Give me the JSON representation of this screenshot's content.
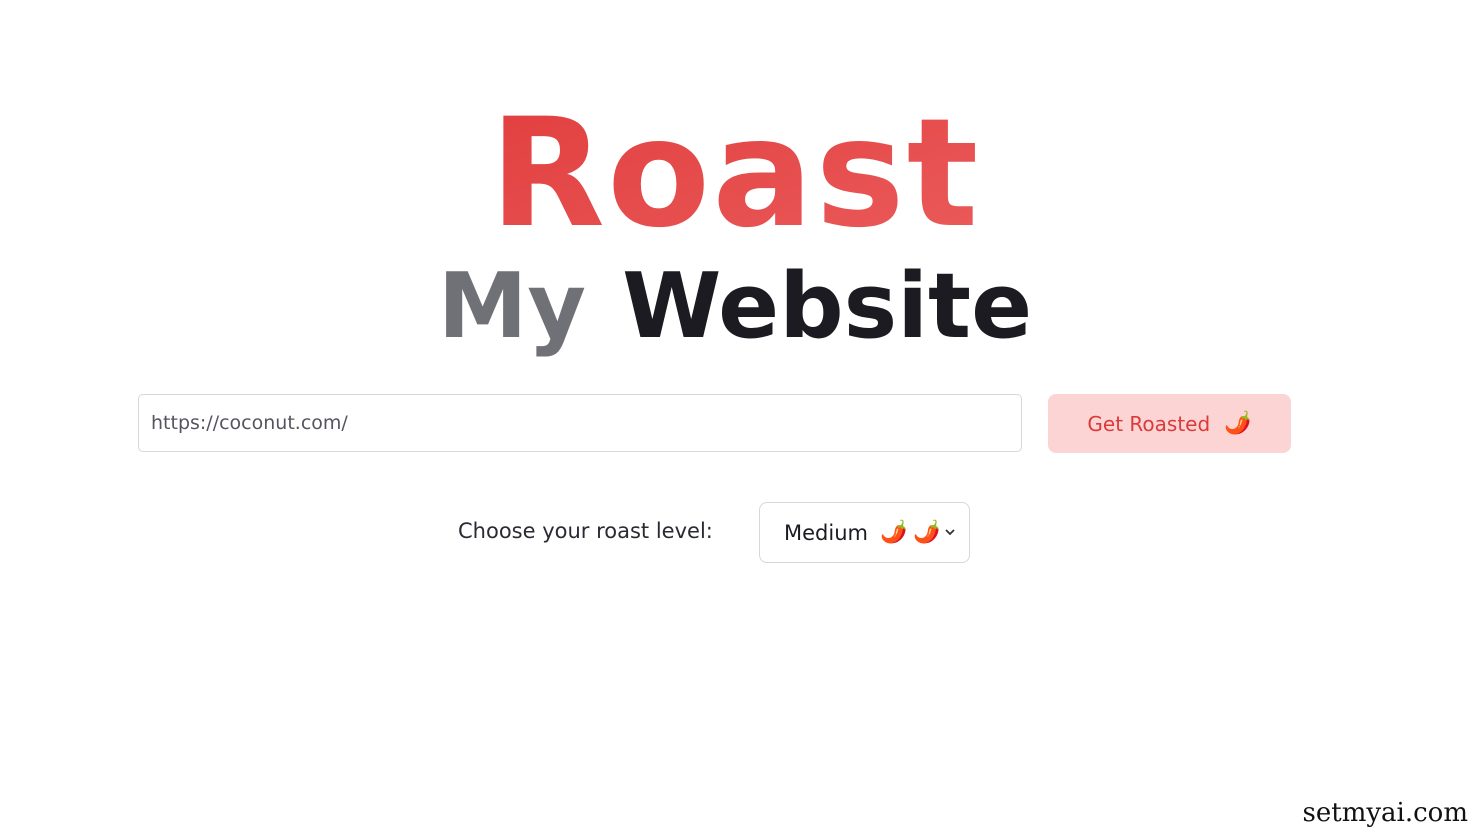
{
  "hero": {
    "title": "Roast",
    "subtitle_my": "My",
    "subtitle_website": "Website"
  },
  "url_input": {
    "value": "https://coconut.com/",
    "placeholder": "https://coconut.com/"
  },
  "roast_button": {
    "label": "Get Roasted",
    "icon": "🌶️"
  },
  "roast_level": {
    "label": "Choose your roast level:",
    "selected": "Medium",
    "icons": [
      "🌶️",
      "🌶️"
    ],
    "chevron": "chevron-down-icon"
  },
  "watermark": "setmyai.com",
  "colors": {
    "title_red": "#e5383b",
    "button_bg": "#fdd4d4",
    "button_text": "#d93a3a",
    "heading_dark": "#1c1b22",
    "heading_gray": "#707077"
  }
}
